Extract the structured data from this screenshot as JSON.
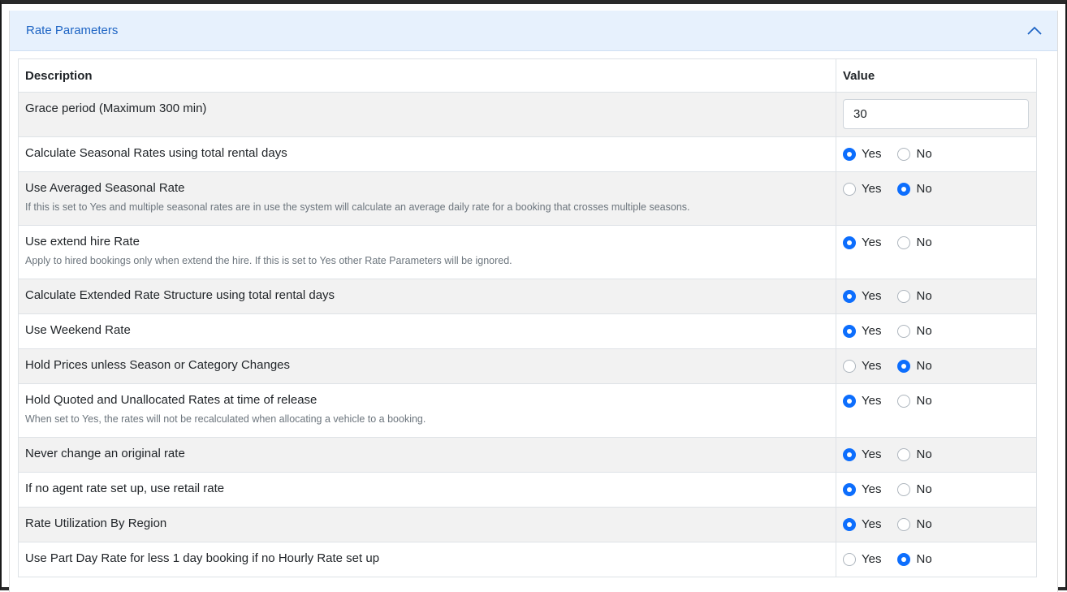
{
  "panel": {
    "title": "Rate Parameters",
    "collapse_icon": "chevron-up-icon"
  },
  "table": {
    "headers": {
      "description": "Description",
      "value": "Value"
    },
    "grace": {
      "label": "Grace period (Maximum 300 min)",
      "value": "30"
    },
    "yes_label": "Yes",
    "no_label": "No",
    "rows": [
      {
        "label": "Calculate Seasonal Rates using total rental days",
        "help": "",
        "selected": "Yes"
      },
      {
        "label": "Use Averaged Seasonal Rate",
        "help": "If this is set to Yes and multiple seasonal rates are in use the system will calculate an average daily rate for a booking that crosses multiple seasons.",
        "selected": "No"
      },
      {
        "label": "Use extend hire Rate",
        "help": "Apply to hired bookings only when extend the hire. If this is set to Yes other Rate Parameters will be ignored.",
        "selected": "Yes"
      },
      {
        "label": "Calculate Extended Rate Structure using total rental days",
        "help": "",
        "selected": "Yes"
      },
      {
        "label": "Use Weekend Rate",
        "help": "",
        "selected": "Yes"
      },
      {
        "label": "Hold Prices unless Season or Category Changes",
        "help": "",
        "selected": "No"
      },
      {
        "label": "Hold Quoted and Unallocated Rates at time of release",
        "help": "When set to Yes, the rates will not be recalculated when allocating a vehicle to a booking.",
        "selected": "Yes"
      },
      {
        "label": "Never change an original rate",
        "help": "",
        "selected": "Yes"
      },
      {
        "label": "If no agent rate set up, use retail rate",
        "help": "",
        "selected": "Yes"
      },
      {
        "label": "Rate Utilization By Region",
        "help": "",
        "selected": "Yes"
      },
      {
        "label": "Use Part Day Rate for less 1 day booking if no Hourly Rate set up",
        "help": "",
        "selected": "No"
      }
    ]
  },
  "colors": {
    "accent": "#0d6efd",
    "header_bg": "#e7f1fd",
    "header_text": "#1d64c4",
    "stripe": "#f2f2f2"
  }
}
